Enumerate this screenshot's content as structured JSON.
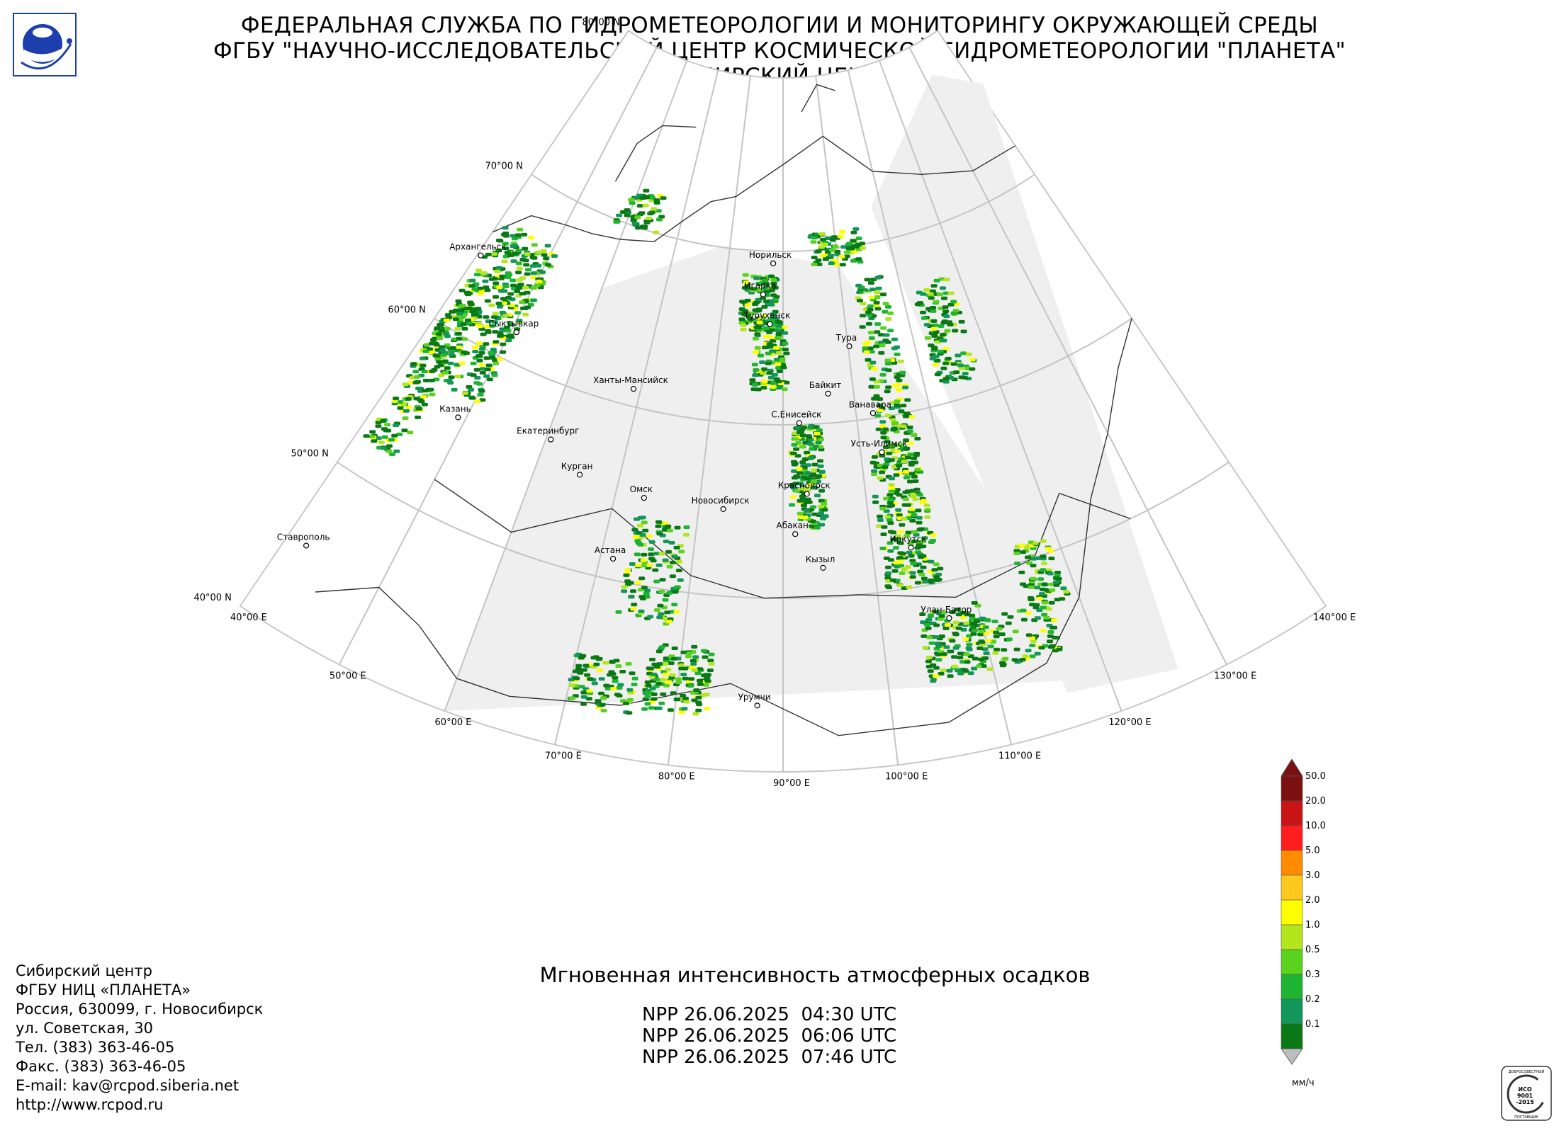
{
  "header": {
    "line1": "ФЕДЕРАЛЬНАЯ СЛУЖБА ПО ГИДРОМЕТЕОРОЛОГИИ И МОНИТОРИНГУ ОКРУЖАЮЩЕЙ СРЕДЫ",
    "line2": "ФГБУ \"НАУЧНО-ИССЛЕДОВАТЕЛЬСКИЙ ЦЕНТР КОСМИЧЕСКОЙ ГИДРОМЕТЕОРОЛОГИИ \"ПЛАНЕТА\"",
    "line3": "СИБИРСКИЙ ЦЕНТР"
  },
  "logo_icon": "planeta-logo-icon",
  "map": {
    "projection": "conic",
    "lat_labels": [
      {
        "lat": 80,
        "label": "80°00 N"
      },
      {
        "lat": 70,
        "label": "70°00 N"
      },
      {
        "lat": 60,
        "label": "60°00 N"
      },
      {
        "lat": 50,
        "label": "50°00 N"
      },
      {
        "lat": 40,
        "label": "40°00 N"
      }
    ],
    "lon_labels": [
      {
        "lon": 40,
        "label": "40°00 E"
      },
      {
        "lon": 50,
        "label": "50°00 E"
      },
      {
        "lon": 60,
        "label": "60°00 E"
      },
      {
        "lon": 70,
        "label": "70°00 E"
      },
      {
        "lon": 80,
        "label": "80°00 E"
      },
      {
        "lon": 90,
        "label": "90°00 E"
      },
      {
        "lon": 100,
        "label": "100°00 E"
      },
      {
        "lon": 110,
        "label": "110°00 E"
      },
      {
        "lon": 120,
        "label": "120°00 E"
      },
      {
        "lon": 130,
        "label": "130°00 E"
      },
      {
        "lon": 140,
        "label": "140°00 E"
      }
    ],
    "cities": [
      {
        "name": "Архангельск",
        "lon": 40.5,
        "lat": 64.5
      },
      {
        "name": "Сыктывкар",
        "lon": 50.8,
        "lat": 61.7
      },
      {
        "name": "Казань",
        "lon": 49.1,
        "lat": 55.8
      },
      {
        "name": "Ставрополь",
        "lon": 42.0,
        "lat": 45.0
      },
      {
        "name": "Екатеринбург",
        "lon": 60.6,
        "lat": 56.8
      },
      {
        "name": "Ханты-Мансийск",
        "lon": 69.0,
        "lat": 61.0
      },
      {
        "name": "Курган",
        "lon": 65.3,
        "lat": 55.4
      },
      {
        "name": "Омск",
        "lon": 73.4,
        "lat": 55.0
      },
      {
        "name": "Новосибирск",
        "lon": 82.9,
        "lat": 55.0
      },
      {
        "name": "Астана",
        "lon": 71.4,
        "lat": 51.2
      },
      {
        "name": "Урумчи",
        "lon": 87.6,
        "lat": 43.8
      },
      {
        "name": "Норильск",
        "lon": 88.2,
        "lat": 69.3
      },
      {
        "name": "Игарка",
        "lon": 86.6,
        "lat": 67.5
      },
      {
        "name": "Туруханск",
        "lon": 87.9,
        "lat": 65.8
      },
      {
        "name": "Тура",
        "lon": 100.2,
        "lat": 64.3
      },
      {
        "name": "Байкит",
        "lon": 96.4,
        "lat": 61.7
      },
      {
        "name": "С.Енисейск",
        "lon": 92.2,
        "lat": 60.1
      },
      {
        "name": "Ванавара",
        "lon": 102.3,
        "lat": 60.3
      },
      {
        "name": "Усть-Илимск",
        "lon": 102.7,
        "lat": 58.0
      },
      {
        "name": "Красноярск",
        "lon": 92.9,
        "lat": 56.0
      },
      {
        "name": "Абакан",
        "lon": 91.4,
        "lat": 53.7
      },
      {
        "name": "Кызыл",
        "lon": 94.4,
        "lat": 51.7
      },
      {
        "name": "Иркутск",
        "lon": 104.3,
        "lat": 52.3
      },
      {
        "name": "Улан-Батор",
        "lon": 106.9,
        "lat": 47.9
      }
    ]
  },
  "contacts": {
    "lines": [
      "Сибирский центр",
      "ФГБУ НИЦ «ПЛАНЕТА»",
      "Россия, 630099, г. Новосибирск",
      "ул. Советская, 30",
      "Тел. (383) 363-46-05",
      "Факс. (383) 363-46-05",
      "E-mail: kav@rcpod.siberia.net",
      "http://www.rcpod.ru"
    ]
  },
  "product": {
    "title": "Мгновенная интенсивность атмосферных осадков",
    "passes": [
      "NPP 26.06.2025  04:30 UTC",
      "NPP 26.06.2025  06:06 UTC",
      "NPP 26.06.2025  07:46 UTC"
    ]
  },
  "legend": {
    "unit": "мм/ч",
    "levels": [
      {
        "label": "50.0",
        "color": "#7a1010"
      },
      {
        "label": "20.0",
        "color": "#c81414"
      },
      {
        "label": "10.0",
        "color": "#ff1e1e"
      },
      {
        "label": "5.0",
        "color": "#ff8c00"
      },
      {
        "label": "3.0",
        "color": "#ffc81e"
      },
      {
        "label": "2.0",
        "color": "#ffff00"
      },
      {
        "label": "1.0",
        "color": "#b4e61e"
      },
      {
        "label": "0.5",
        "color": "#5ad21e"
      },
      {
        "label": "0.3",
        "color": "#1eb432"
      },
      {
        "label": "0.2",
        "color": "#12965a"
      },
      {
        "label": "0.1",
        "color": "#0a7814"
      }
    ]
  },
  "iso_badge": {
    "top_text": "ДОБРОСОВЕСТНЫЙ",
    "lines": [
      "ИСО",
      "9001",
      "-2015"
    ],
    "bottom_text": "ПОСТАВЩИК"
  }
}
